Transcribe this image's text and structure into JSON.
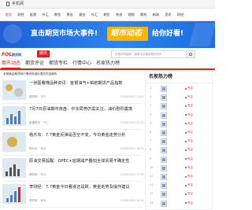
{
  "topbar": {
    "phone_label": "手机网"
  },
  "nav": [
    "首页",
    "财经",
    "股票",
    "外汇",
    "期货",
    "黄金",
    "基金",
    "外汇",
    "期货",
    "原油",
    "理财",
    "期权",
    "新闻",
    "资讯",
    "财经"
  ],
  "banner": {
    "text_left": "直击期货市场大事件!",
    "text_highlight": "期市动态",
    "text_right": "给你好看!"
  },
  "header": {
    "logo_main": "FOL",
    "logo_sub": "期货网",
    "page_chip": "期讯"
  },
  "search": {
    "placeholder": "在期货网搜索 · 搜索本站最新期货资讯"
  },
  "tabs": [
    "期市动态",
    "期货评论",
    "期货专栏",
    "行情中心",
    "名家热力榜"
  ],
  "hint": "本频道由期货网行情资讯团队提供内容服务",
  "news": [
    {
      "title": "一张图看懂品种资讯：金银油气+铂钯期货产品指数",
      "source": "期货网",
      "tag": "资讯",
      "time": "07/06/2024 21:05"
    },
    {
      "title": "7月7日原油期市夜盘：中东局势仍需关注，油价剧烈震荡",
      "source": "金银财讯",
      "tag": "外汇",
      "time": "07/06/2024 20:43"
    },
    {
      "title": "杨乐东：7.7黄金反弹是否空不变，今日黄金走势分析",
      "source": "杨乐东",
      "tag": "黄金",
      "time": "07/06/2024 18:52"
    },
    {
      "title": "原油交易提醒：OPEC+延期减产叠加全球贸易不确定性",
      "source": "期货网",
      "tag": "原油",
      "time": "07/06/2024 17:30"
    },
    {
      "title": "李财经：7.7黄金今日看涨还是跌，黄金走势及操作建议",
      "source": "李财经",
      "tag": "黄金",
      "time": "07/06/2024 16:18"
    }
  ],
  "side": {
    "heading": "名家热力榜",
    "ranks": [
      {
        "num": "1",
        "tag": "专注"
      },
      {
        "num": "2",
        "tag": "专注"
      },
      {
        "num": "3",
        "tag": "专注"
      },
      {
        "num": "4",
        "tag": "专注"
      },
      {
        "num": "5",
        "tag": "专注"
      },
      {
        "num": "6",
        "tag": "专注"
      },
      {
        "num": "7",
        "tag": "专注"
      },
      {
        "num": "8",
        "tag": "专注"
      },
      {
        "num": "9",
        "tag": "专注"
      },
      {
        "num": "10",
        "tag": "专注"
      },
      {
        "num": "11",
        "tag": "专注"
      },
      {
        "num": "12",
        "tag": "专注"
      },
      {
        "num": "13",
        "tag": "专注"
      },
      {
        "num": "14",
        "tag": "专注"
      }
    ]
  }
}
